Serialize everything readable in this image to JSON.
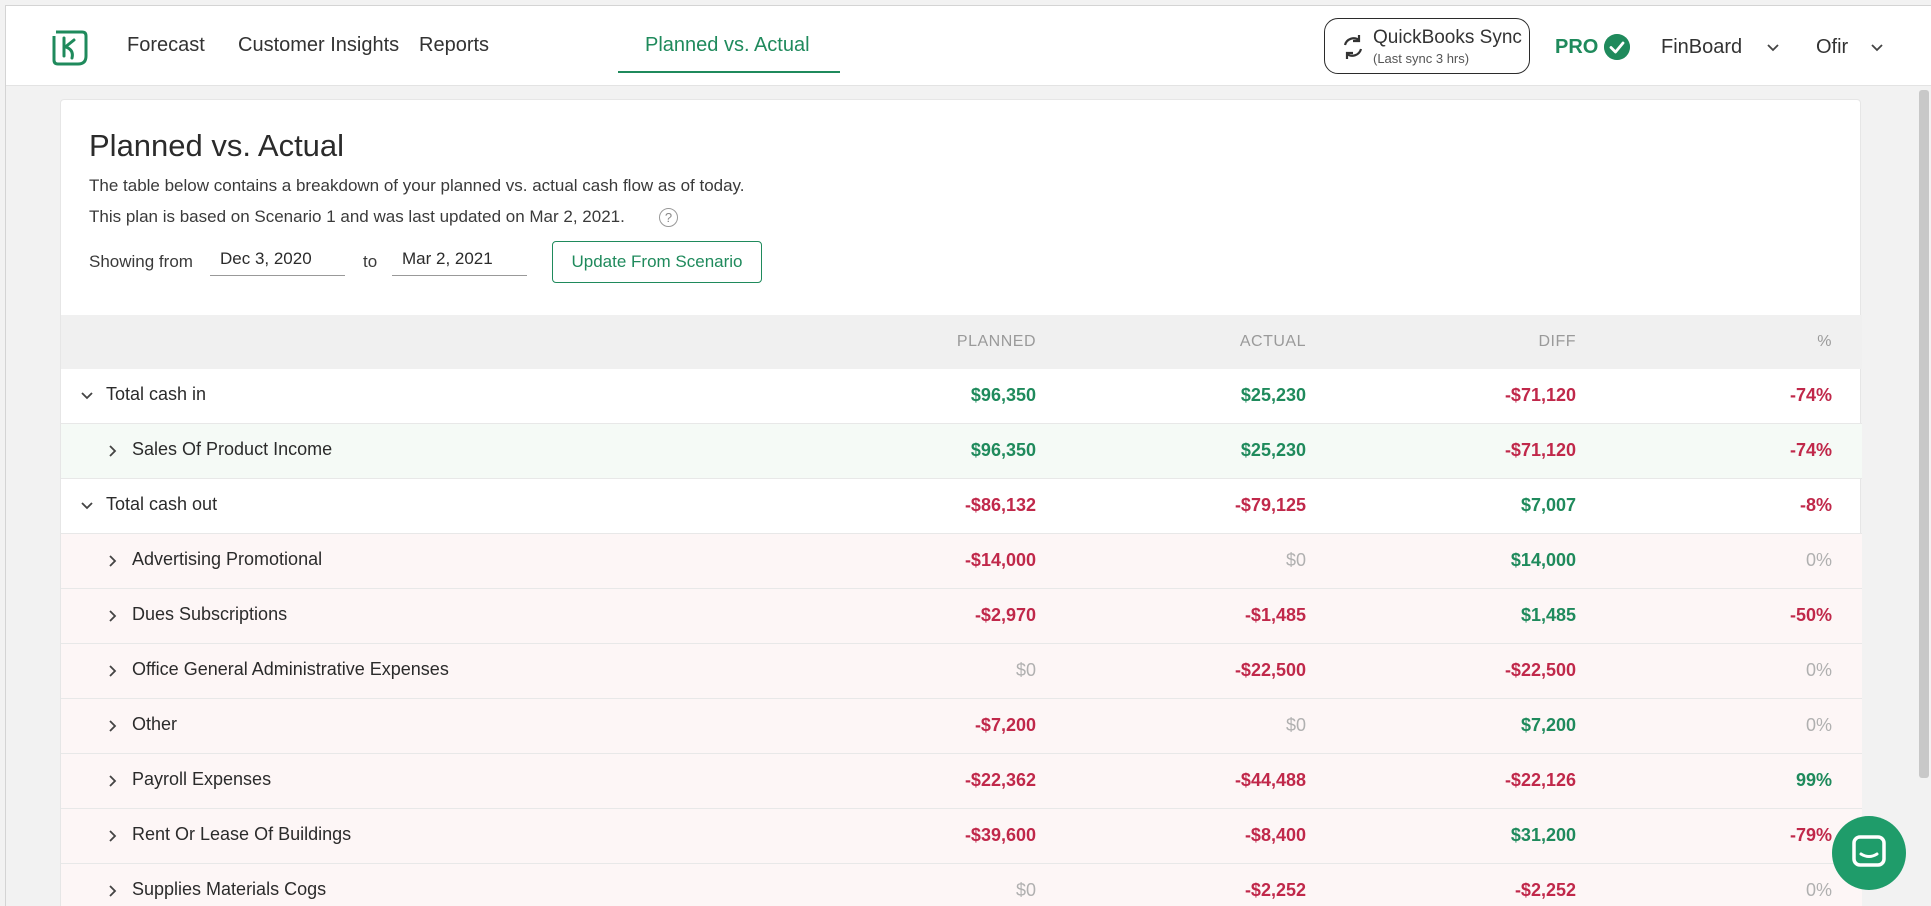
{
  "nav": {
    "items": [
      {
        "label": "Forecast"
      },
      {
        "label": "Customer Insights"
      },
      {
        "label": "Reports"
      },
      {
        "label": "Planned vs. Actual"
      }
    ],
    "sync_title": "QuickBooks Sync",
    "sync_sub": "(Last sync 3 hrs)",
    "pro_label": "PRO",
    "company": "FinBoard",
    "user": "Ofir"
  },
  "page": {
    "title": "Planned vs. Actual",
    "desc1": "The table below contains a breakdown of your planned vs. actual cash flow as of today.",
    "desc2": "This plan is based on Scenario 1 and was last updated on Mar 2, 2021.",
    "help": "?",
    "showing_from": "Showing from",
    "date_from": "Dec 3, 2020",
    "to": "to",
    "date_to": "Mar 2, 2021",
    "update_button": "Update From Scenario"
  },
  "table": {
    "headers": {
      "planned": "PLANNED",
      "actual": "ACTUAL",
      "diff": "DIFF",
      "pct": "%"
    },
    "rows": [
      {
        "label": "Total cash in",
        "planned": "$96,350",
        "actual": "$25,230",
        "diff": "-$71,120",
        "pct": "-74%"
      },
      {
        "label": "Sales Of Product Income",
        "planned": "$96,350",
        "actual": "$25,230",
        "diff": "-$71,120",
        "pct": "-74%"
      },
      {
        "label": "Total cash out",
        "planned": "-$86,132",
        "actual": "-$79,125",
        "diff": "$7,007",
        "pct": "-8%"
      },
      {
        "label": "Advertising Promotional",
        "planned": "-$14,000",
        "actual": "$0",
        "diff": "$14,000",
        "pct": "0%"
      },
      {
        "label": "Dues Subscriptions",
        "planned": "-$2,970",
        "actual": "-$1,485",
        "diff": "$1,485",
        "pct": "-50%"
      },
      {
        "label": "Office General Administrative Expenses",
        "planned": "$0",
        "actual": "-$22,500",
        "diff": "-$22,500",
        "pct": "0%"
      },
      {
        "label": "Other",
        "planned": "-$7,200",
        "actual": "$0",
        "diff": "$7,200",
        "pct": "0%"
      },
      {
        "label": "Payroll Expenses",
        "planned": "-$22,362",
        "actual": "-$44,488",
        "diff": "-$22,126",
        "pct": "99%"
      },
      {
        "label": "Rent Or Lease Of Buildings",
        "planned": "-$39,600",
        "actual": "-$8,400",
        "diff": "$31,200",
        "pct": "-79%"
      },
      {
        "label": "Supplies Materials Cogs",
        "planned": "$0",
        "actual": "-$2,252",
        "diff": "-$2,252",
        "pct": "0%"
      }
    ]
  },
  "colors": {
    "brand": "#1f8a5c",
    "negative": "#c0284a",
    "muted": "#b0b0b0"
  }
}
